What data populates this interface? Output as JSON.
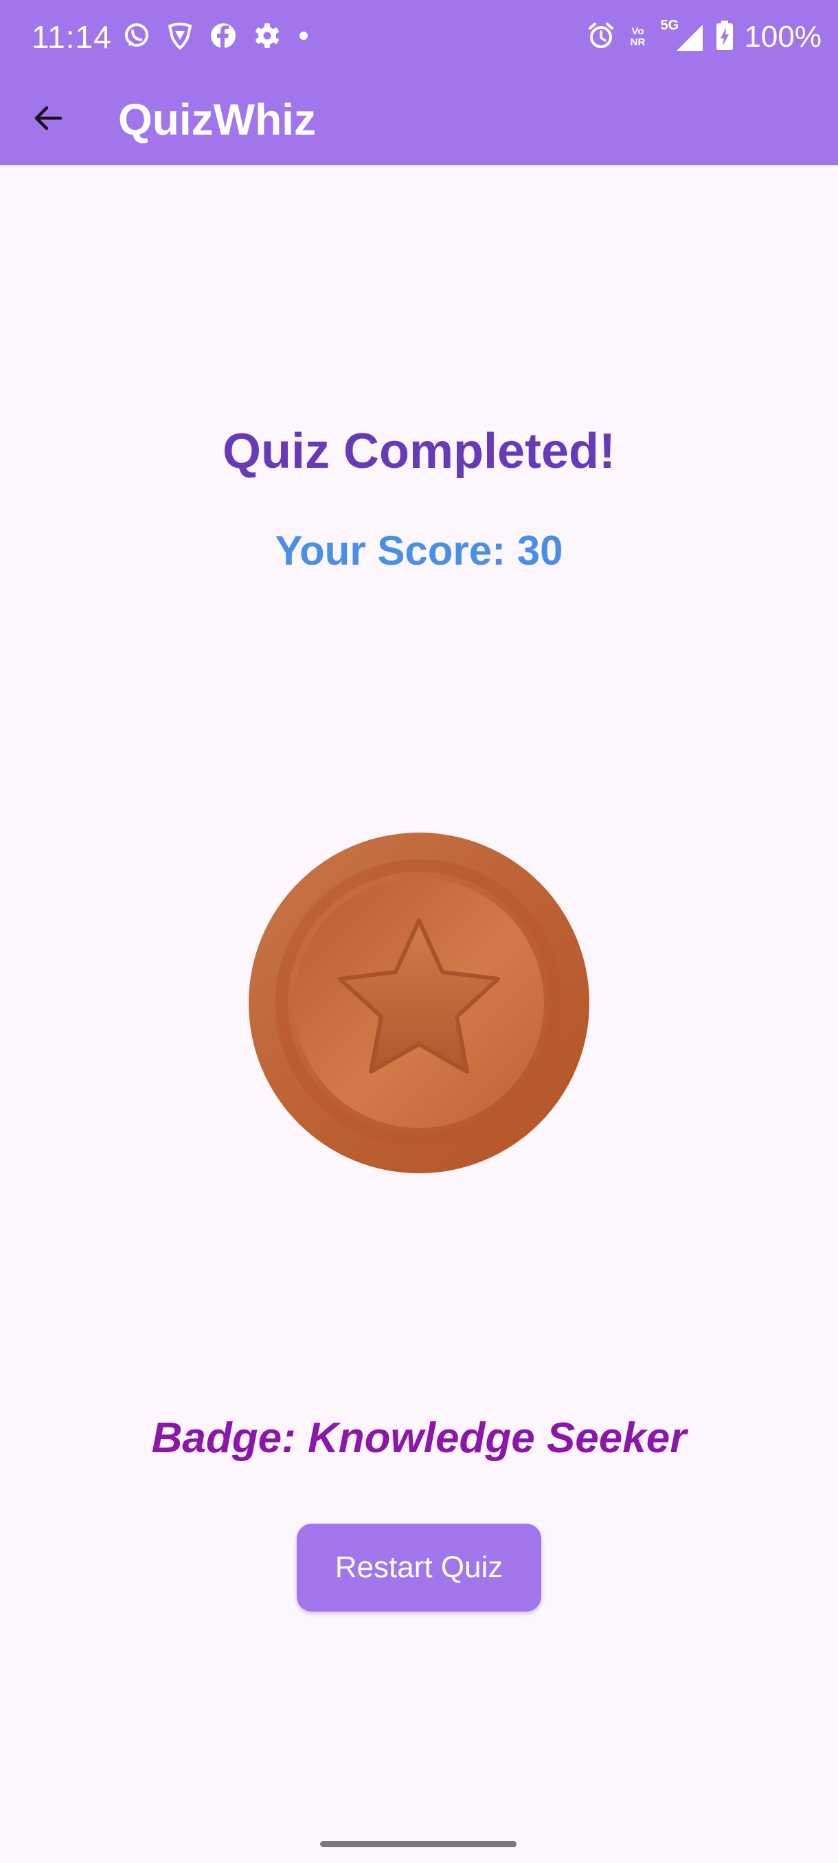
{
  "status_bar": {
    "time": "11:14",
    "battery": "100%",
    "network_top": "Vo",
    "network_bottom": "NR",
    "network_type": "5G",
    "left_icons": [
      "whatsapp-icon",
      "vpn-shield-icon",
      "facebook-icon",
      "settings-gear-icon",
      "notification-dot-icon"
    ],
    "right_icons": [
      "alarm-icon",
      "volte-nr-icon",
      "signal-5g-icon",
      "battery-charging-icon"
    ]
  },
  "app_bar": {
    "title": "QuizWhiz",
    "back_icon": "arrow-back-icon"
  },
  "result": {
    "title": "Quiz Completed!",
    "score": "Your Score: 30",
    "badge": "Badge: Knowledge Seeker",
    "medal_icon": "bronze-star-medal-icon"
  },
  "actions": {
    "restart_label": "Restart Quiz"
  },
  "colors": {
    "primary": "#a176ec",
    "background": "#fdf6fc",
    "title": "#673ab7",
    "score": "#4a8fe7",
    "badge": "#8b17a8",
    "medal_bronze": "#c8683a"
  }
}
